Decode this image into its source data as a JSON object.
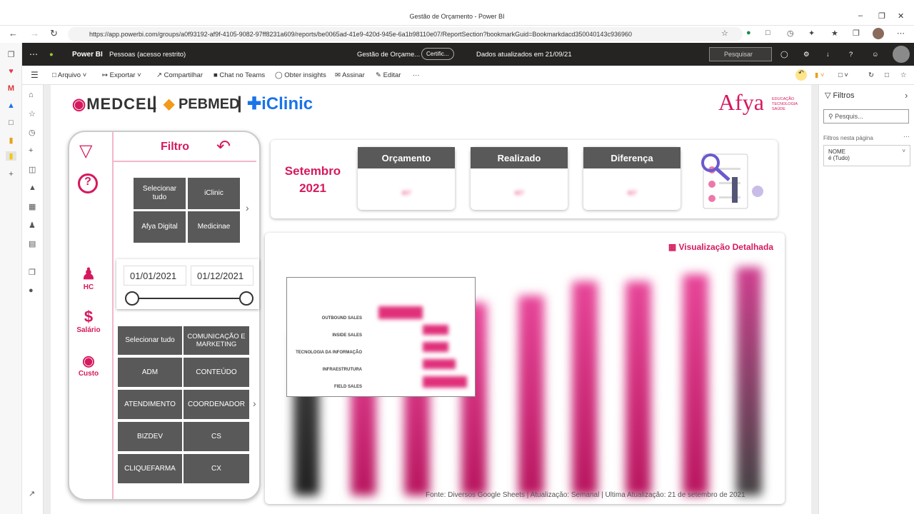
{
  "browser": {
    "window_title": "Gestão de Orçamento - Power BI",
    "url": "https://app.powerbi.com/groups/a0f93192-af9f-4105-9082-97ff8231a609/reports/be0065ad-41e9-420d-945e-6a1b98110e07/ReportSection?bookmarkGuid=Bookmarkdacd350040143c936960"
  },
  "pbi_header": {
    "app": "Power BI",
    "workspace": "Pessoas (acesso restrito)",
    "report": "Gestão de Orçame...",
    "cert": "Certific...",
    "updated": "Dados atualizados em 21/09/21",
    "search_placeholder": "Pesquisar"
  },
  "cmdbar": {
    "arquivo": "Arquivo",
    "exportar": "Exportar",
    "compartilhar": "Compartilhar",
    "chat": "Chat no Teams",
    "insights": "Obter insights",
    "assinar": "Assinar",
    "editar": "Editar",
    "more": "···"
  },
  "logos": {
    "medcel": "MEDCEL",
    "pebmed": "PEBMED",
    "iclinic": "iClinic",
    "afya": "Afya",
    "afya_tag": [
      "EDUCAÇÃO",
      "TECNOLOGIA",
      "SAÚDE"
    ]
  },
  "filter_panel": {
    "title": "Filtro",
    "side": {
      "hc": "HC",
      "salario": "Salário",
      "custo": "Custo"
    },
    "company_buttons": [
      "Selecionar tudo",
      "iClinic",
      "Afya Digital",
      "Medicinae"
    ],
    "date_start": "01/01/2021",
    "date_end": "01/12/2021",
    "area_buttons": [
      "Selecionar tudo",
      "COMUNICAÇÃO E MARKETING",
      "ADM",
      "CONTEÚDO",
      "ATENDIMENTO",
      "COORDENADOR",
      "BIZDEV",
      "CS",
      "CLIQUEFARMA",
      "CX"
    ]
  },
  "period": {
    "month": "Setembro",
    "year": "2021"
  },
  "kpis": [
    {
      "label": "Orçamento",
      "value": "407"
    },
    {
      "label": "Realizado",
      "value": "407"
    },
    {
      "label": "Diferença",
      "value": "407"
    }
  ],
  "detail_link": "Visualização Detalhada",
  "popup_rows": [
    "OUTBOUND SALES",
    "INSIDE SALES",
    "TECNOLOGIA DA INFORMAÇÃO",
    "INFRAESTRUTURA",
    "FIELD SALES"
  ],
  "footer": "Fonte: Diversos Google Sheets | Atualização: Semanal | Última Atualização: 21 de setembro de 2021",
  "filters_pane": {
    "title": "Filtros",
    "search": "Pesquis...",
    "section": "Filtros nesta página",
    "card_field": "NOME",
    "card_value": "é (Tudo)"
  },
  "colors": {
    "accent": "#d6195e",
    "dark_button": "#595959",
    "pbi_header": "#252423"
  }
}
